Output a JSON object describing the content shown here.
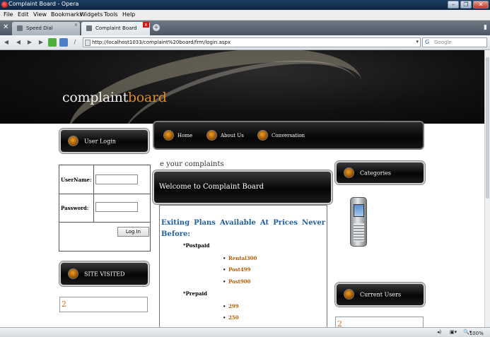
{
  "window": {
    "title": "Complaint Board - Opera",
    "minimize": "–",
    "maximize": "❐",
    "close": "✕"
  },
  "menu": [
    "File",
    "Edit",
    "View",
    "Bookmarks",
    "Widgets",
    "Tools",
    "Help"
  ],
  "tabs": [
    {
      "label": "Speed Dial",
      "active": false
    },
    {
      "label": "Complaint Board",
      "active": true
    }
  ],
  "address": {
    "url": "http://localhost1033/complaint%20board/frm/login.aspx",
    "search_placeholder": "Google"
  },
  "site": {
    "logo_part1": "complaint",
    "logo_part2": "board",
    "nav": [
      "Home",
      "About Us",
      "Conversation"
    ],
    "tagline": "e your complaints",
    "user_login_label": "User Login",
    "login": {
      "username_label": "UserName:",
      "password_label": "Password:",
      "username_value": "",
      "password_value": "",
      "button": "Log In"
    },
    "site_visited_label": "SITE VISITED",
    "site_visited_count": "2",
    "welcome": "Welcome to Complaint Board",
    "plans_heading_line1": "Exiting Plans Available At Prices Never",
    "plans_heading_line2": "Before:",
    "postpaid_label": "*Postpaid",
    "postpaid_items": [
      "Rental300",
      "Post499",
      "Post900"
    ],
    "prepaid_label": "*Prepaid",
    "prepaid_items": [
      "299",
      "250"
    ],
    "categories_label": "Categories",
    "current_users_label": "Current Users",
    "current_users_count": "2"
  },
  "status": {
    "zoom": "100%"
  },
  "colors": {
    "accent_orange": "#e08a1e",
    "heading_blue": "#1f5d9c",
    "counter_orange": "#c8702a"
  }
}
